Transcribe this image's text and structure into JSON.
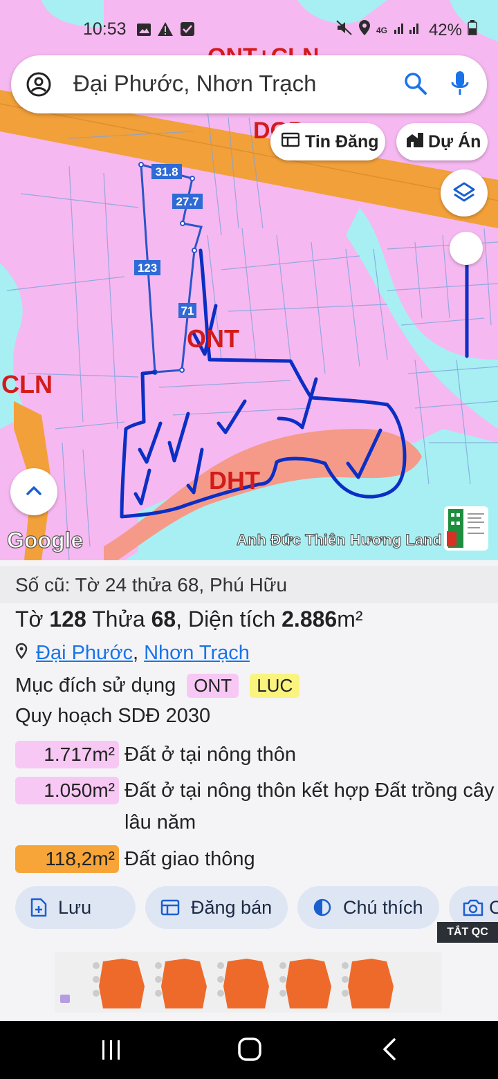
{
  "status_bar": {
    "time": "10:53",
    "battery": "42%",
    "network": "4G"
  },
  "search": {
    "query": "Đại Phước, Nhơn Trạch"
  },
  "map": {
    "chips": {
      "listings": "Tin Đăng",
      "projects": "Dự Án"
    },
    "zone_labels": {
      "ont_top": "ONT+CLN",
      "dgd": "DGD",
      "ont": "ONT",
      "cln": "CLN",
      "dht": "DHT"
    },
    "edge_lengths": [
      "31.8",
      "27.7",
      "123",
      "71"
    ],
    "google_logo": "Google",
    "watermark": "Anh Đức Thiên Hương Land",
    "colors": {
      "residential": "#f6b8f0",
      "road": "#f2a03a",
      "water": "#a7eff3",
      "transport": "#f59a88",
      "boundary": "#1e4fd8"
    }
  },
  "sheet": {
    "old_info": "Số cũ: Tờ 24 thửa 68, Phú Hữu",
    "parcel": {
      "sheet_prefix": "Tờ",
      "sheet_no": "128",
      "parcel_prefix": "Thửa",
      "parcel_no": "68",
      "area_prefix": ", Diện tích",
      "area": "2.886",
      "area_unit": "m²"
    },
    "location": {
      "ward": "Đại Phước",
      "separator": ",",
      "district": "Nhơn Trạch"
    },
    "usage": {
      "label": "Mục đích sử dụng",
      "tags": [
        "ONT",
        "LUC"
      ]
    },
    "plan_title": "Quy hoạch SDĐ 2030",
    "plan_items": [
      {
        "area": "1.717m²",
        "desc": "Đất ở tại nông thôn",
        "color": "#f8c8f4"
      },
      {
        "area": "1.050m²",
        "desc": "Đất ở tại nông thôn kết hợp Đất trồng cây lâu năm",
        "color": "#f8c8f4"
      },
      {
        "area": "118,2m²",
        "desc": "Đất giao thông",
        "color": "#f7a538"
      }
    ],
    "actions": {
      "save": "Lưu",
      "sell": "Đăng bán",
      "legend": "Chú thích",
      "photo": "C"
    },
    "ad_toggle": "TẮT QC"
  }
}
